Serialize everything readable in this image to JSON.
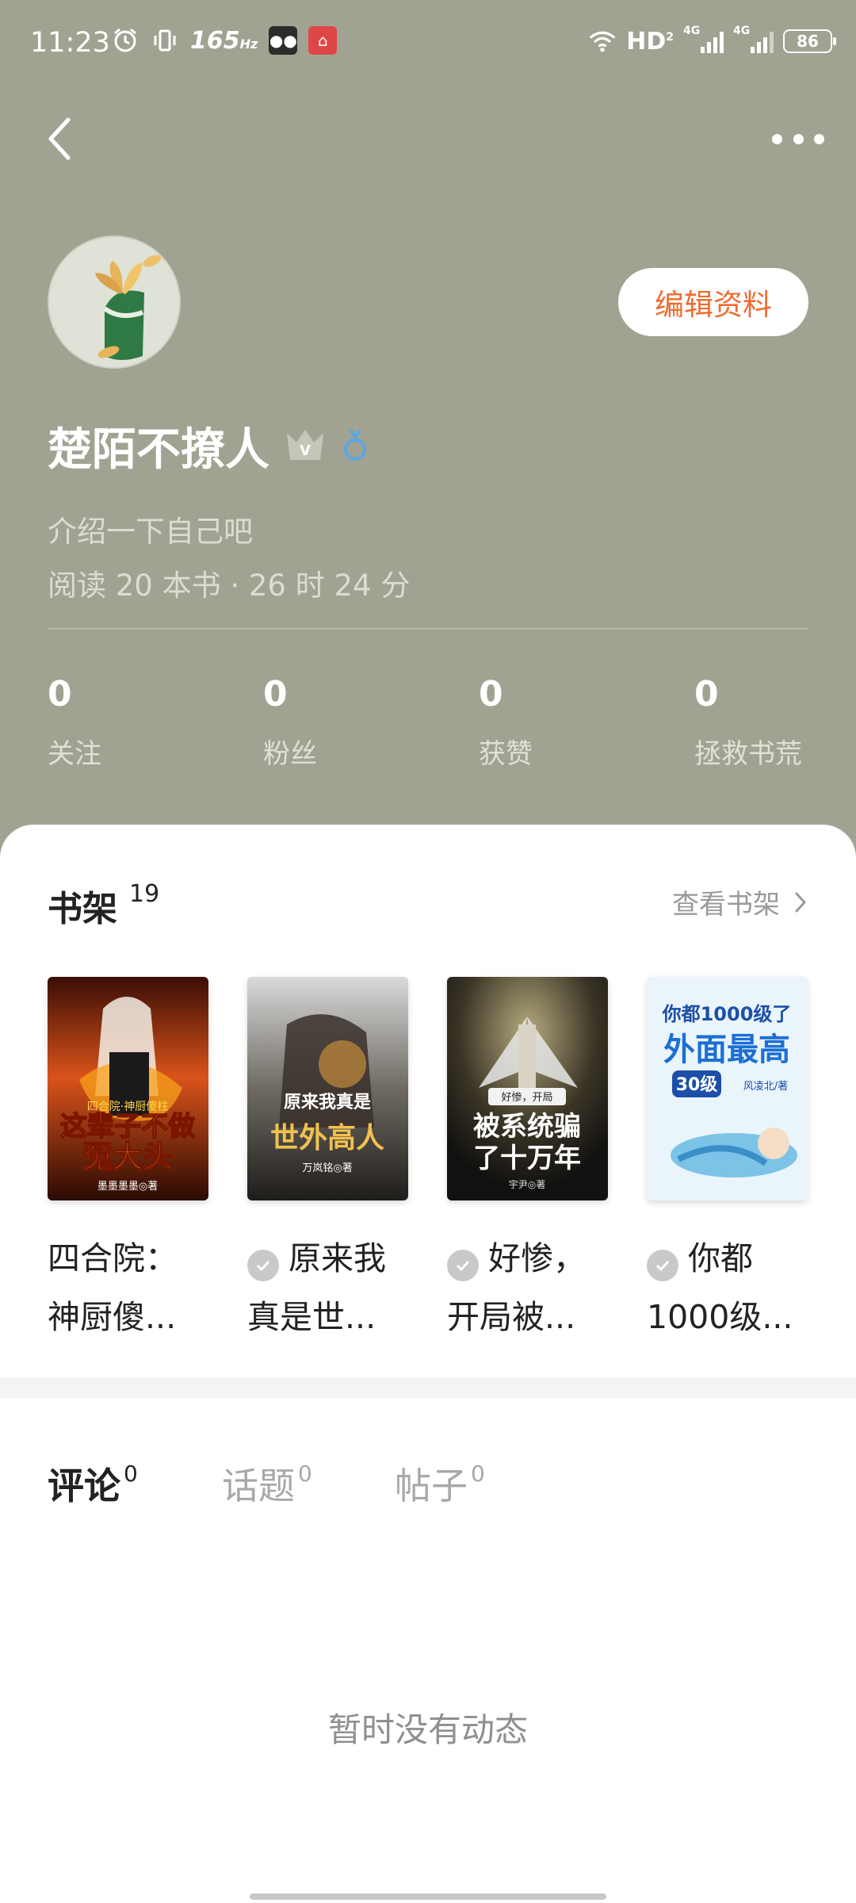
{
  "status_bar": {
    "time": "11:23",
    "refresh_rate": "165",
    "refresh_unit": "Hz",
    "network": "HD",
    "network_sub": "2",
    "signal1_label": "4G",
    "signal2_label": "4G",
    "battery": "86"
  },
  "header": {
    "edit_label": "编辑资料"
  },
  "profile": {
    "username": "楚陌不撩人",
    "bio": "介绍一下自己吧",
    "reading_stats": "阅读 20 本书 · 26 时 24 分"
  },
  "stats": [
    {
      "value": "0",
      "label": "关注"
    },
    {
      "value": "0",
      "label": "粉丝"
    },
    {
      "value": "0",
      "label": "获赞"
    },
    {
      "value": "0",
      "label": "拯救书荒"
    }
  ],
  "shelf": {
    "title": "书架",
    "count": "19",
    "view_label": "查看书架",
    "books": [
      {
        "title_line1": "四合院：",
        "title_line2": "神厨傻...",
        "checked": false,
        "cover_lines": [
          "这辈子不做",
          "冤大头"
        ],
        "cover_tag": "四合院·神厨傻柱",
        "cover_author": "墨墨墨墨◎著"
      },
      {
        "title_line1": "原来我",
        "title_line2": "真是世...",
        "checked": true,
        "cover_lines": [
          "原来我真是",
          "世外高人"
        ],
        "cover_tag": "",
        "cover_author": "万岚铭◎著"
      },
      {
        "title_line1": "好惨，",
        "title_line2": "开局被...",
        "checked": true,
        "cover_lines": [
          "被系统骗",
          "了十万年"
        ],
        "cover_tag": "好惨，开局",
        "cover_author": "宇尹◎著"
      },
      {
        "title_line1": "你都",
        "title_line2": "1000级...",
        "checked": true,
        "cover_lines": [
          "你都1000级了",
          "外面最高",
          "30级"
        ],
        "cover_tag": "",
        "cover_author": "风凌北/著"
      }
    ]
  },
  "tabs": [
    {
      "label": "评论",
      "count": "0",
      "active": true
    },
    {
      "label": "话题",
      "count": "0",
      "active": false
    },
    {
      "label": "帖子",
      "count": "0",
      "active": false
    }
  ],
  "empty_text": "暂时没有动态",
  "colors": {
    "header_bg": "#a1a392",
    "accent": "#ef6b2e"
  }
}
